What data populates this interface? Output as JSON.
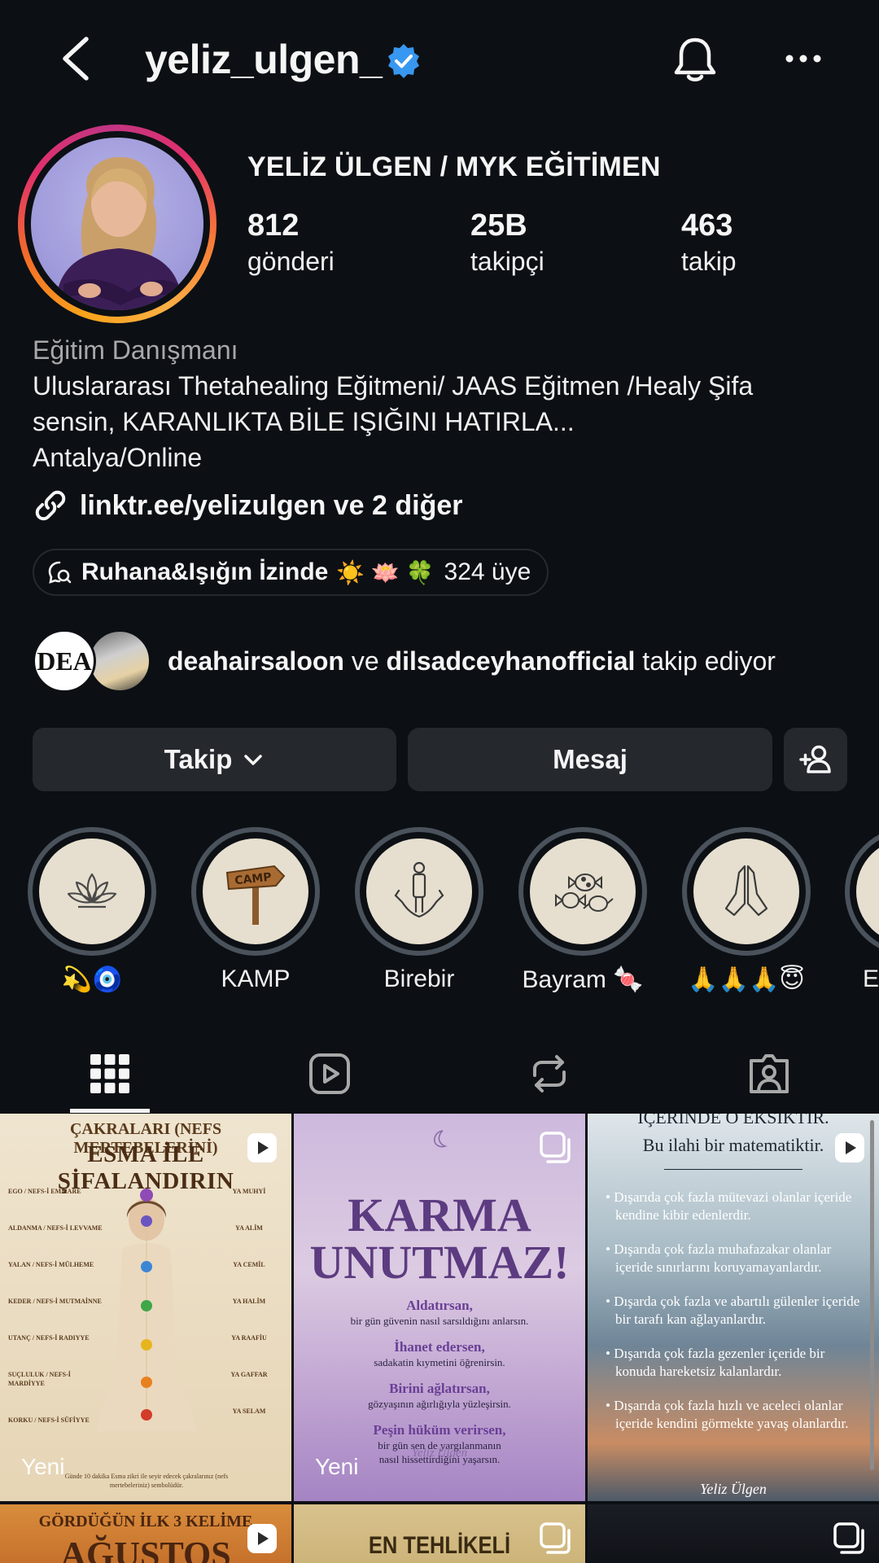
{
  "header": {
    "username": "yeliz_ulgen_",
    "verified": true,
    "icons": [
      "back-arrow-icon",
      "verified-badge-icon",
      "bell-icon",
      "more-options-icon"
    ]
  },
  "profile": {
    "full_name": "YELİZ ÜLGEN / MYK EĞİTİMEN",
    "stats": [
      {
        "value": "812",
        "label": "gönderi"
      },
      {
        "value": "25B",
        "label": "takipçi"
      },
      {
        "value": "463",
        "label": "takip"
      }
    ],
    "category": "Eğitim Danışmanı",
    "bio_line1": "Uluslararası Thetahealing Eğitmeni/ JAAS Eğitmen /Healy Şifa",
    "bio_line2": "sensin, KARANLIKTA BİLE IŞIĞINI HATIRLA...",
    "bio_line3": "Antalya/Online",
    "link": "linktr.ee/yelizulgen ve 2 diğer"
  },
  "channel": {
    "name": "Ruhana&Işığın İzinde",
    "emoji": "☀️ 🪷 🍀",
    "members": "324 üye"
  },
  "followed_by": {
    "avatar1_text": "DEA",
    "user1": "deahairsaloon",
    "connector": "ve",
    "user2": "dilsadceyhanofficial",
    "suffix": "takip ediyor"
  },
  "buttons": {
    "follow": "Takip",
    "message": "Mesaj"
  },
  "highlights": [
    {
      "label": "💫🧿",
      "icon": "lotus-icon"
    },
    {
      "label": "KAMP",
      "icon": "camp-sign-icon"
    },
    {
      "label": "Birebir",
      "icon": "person-hands-icon"
    },
    {
      "label": "Bayram 🍬",
      "icon": "candy-icon"
    },
    {
      "label": "🙏🙏🙏😇",
      "icon": "praying-hands-icon"
    },
    {
      "label": "Eğ",
      "icon": "partial-icon"
    }
  ],
  "tabs": [
    "grid-icon",
    "reels-icon",
    "reposts-icon",
    "tagged-icon"
  ],
  "posts": {
    "p1": {
      "line1": "ÇAKRALARI (NEFS MERTEBELERİNİ)",
      "line2": "ESMA İLE ŞİFALANDIRIN",
      "left": [
        "EGO / NEFS-İ EMMARE",
        "ALDANMA / NEFS-İ LEVVAME",
        "YALAN / NEFS-İ MÜLHEME",
        "KEDER / NEFS-İ MUTMAİNNE",
        "UTANÇ / NEFS-İ RADIYYE",
        "SUÇLULUK / NEFS-İ MARDİYYE",
        "KORKU / NEFS-İ SÜFİYYE"
      ],
      "right": [
        "YA MUHYİ",
        "YA ALİM",
        "YA CEMİL",
        "YA HALİM",
        "YA RAAFİU",
        "YA GAFFAR",
        "YA SELAM"
      ],
      "footer": "Günde 10 dakika Esma zikri ile seyir edecek çakralarınız (nefs mertebeleriniz) sembolüdür.",
      "new_label": "Yeni"
    },
    "p2": {
      "title1": "KARMA",
      "title2": "UNUTMAZ!",
      "h1": "Aldatırsan,",
      "s1": "bir gün güvenin nasıl sarsıldığını anlarsın.",
      "h2": "İhanet edersen,",
      "s2": "sadakatin kıymetini öğrenirsin.",
      "h3": "Birini ağlatırsan,",
      "s3": "gözyaşının ağırlığıyla yüzleşirsin.",
      "h4": "Peşin hüküm verirsen,",
      "s4a": "bir gün sen de yargılanmanın",
      "s4b": "nasıl hissettirdiğini yaşarsın.",
      "signature": "Yeliz Ülgen",
      "new_label": "Yeni"
    },
    "p3": {
      "top1": "İÇERİNDE O EKSİKTİR.",
      "top2": "Bu ilahi bir matematiktir.",
      "bullets": [
        "Dışarıda çok fazla mütevazi olanlar içeride kendine kibir edenlerdir.",
        "Dışarıda çok fazla muhafazakar olanlar içeride sınırlarını koruyamayanlardır.",
        "Dışarda çok fazla ve abartılı gülenler içeride bir tarafı kan ağlayanlardır.",
        "Dışarıda çok fazla gezenler içeride bir konuda hareketsiz kalanlardır.",
        "Dışarıda çok fazla hızlı ve aceleci olanlar içeride kendini görmekte yavaş olanlardır."
      ],
      "signature": "Yeliz Ülgen"
    },
    "p4": {
      "line1": "GÖRDÜĞÜN İLK 3 KELİME",
      "line2": "AĞUSTOS"
    },
    "p5": {
      "text": "EN TEHLİKELİ"
    }
  }
}
